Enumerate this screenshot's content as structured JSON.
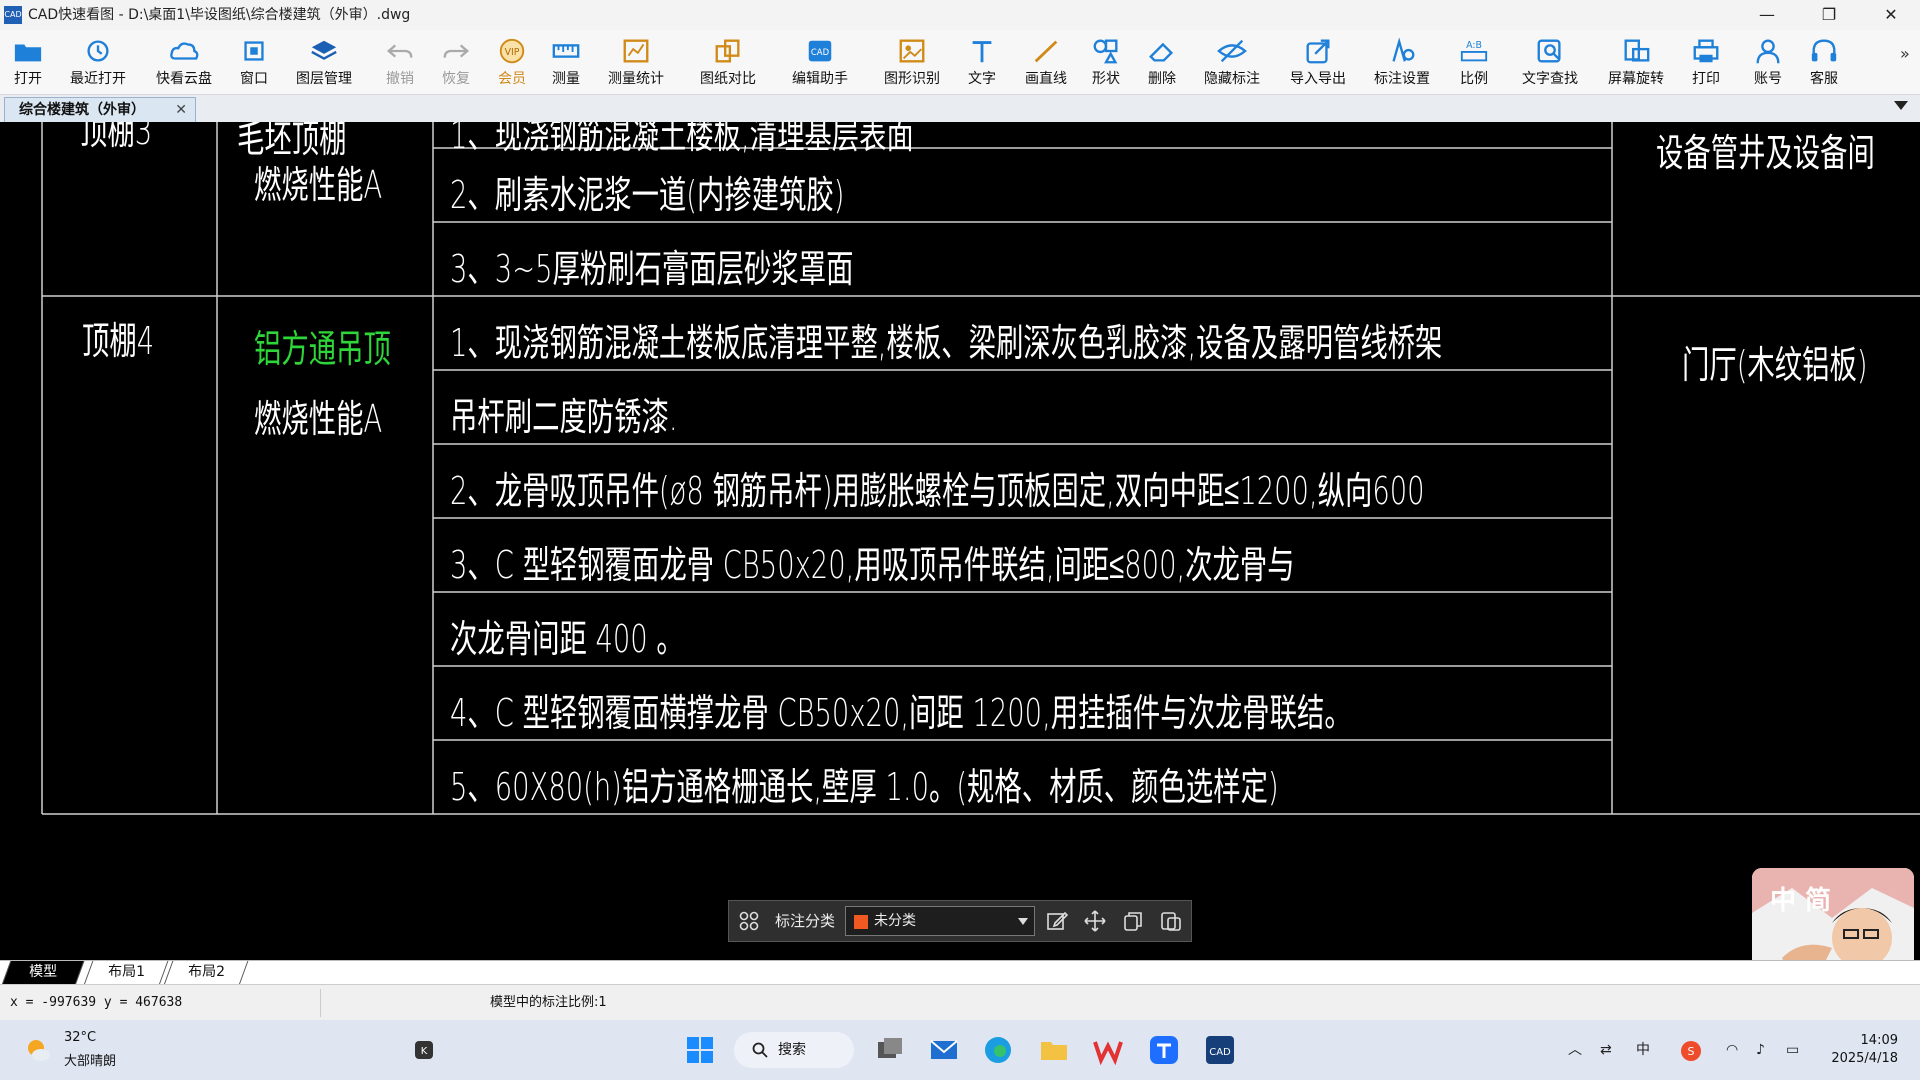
{
  "window": {
    "title": "CAD快速看图 - D:\\桌面1\\毕设图纸\\综合楼建筑（外审）.dwg",
    "controls": [
      "—",
      "❐",
      "✕"
    ]
  },
  "toolbar": [
    {
      "label": "打开",
      "icon": "folder-open-icon"
    },
    {
      "label": "最近打开",
      "icon": "history-icon"
    },
    {
      "label": "快看云盘",
      "icon": "cloud-icon"
    },
    {
      "label": "窗口",
      "icon": "window-icon"
    },
    {
      "label": "图层管理",
      "icon": "layers-icon"
    },
    {
      "label": "撤销",
      "icon": "undo-icon"
    },
    {
      "label": "恢复",
      "icon": "redo-icon"
    },
    {
      "label": "会员",
      "icon": "vip-icon"
    },
    {
      "label": "测量",
      "icon": "ruler-icon"
    },
    {
      "label": "测量统计",
      "icon": "measure-stats-icon"
    },
    {
      "label": "图纸对比",
      "icon": "compare-icon"
    },
    {
      "label": "编辑助手",
      "icon": "edit-assistant-icon"
    },
    {
      "label": "图形识别",
      "icon": "shape-recognition-icon"
    },
    {
      "label": "文字",
      "icon": "text-icon"
    },
    {
      "label": "画直线",
      "icon": "line-icon"
    },
    {
      "label": "形状",
      "icon": "shape-icon"
    },
    {
      "label": "删除",
      "icon": "eraser-icon"
    },
    {
      "label": "隐藏标注",
      "icon": "hide-annotation-icon"
    },
    {
      "label": "导入导出",
      "icon": "import-export-icon"
    },
    {
      "label": "标注设置",
      "icon": "annotation-settings-icon"
    },
    {
      "label": "比例",
      "icon": "scale-icon"
    },
    {
      "label": "文字查找",
      "icon": "text-search-icon"
    },
    {
      "label": "屏幕旋转",
      "icon": "rotate-screen-icon"
    },
    {
      "label": "打印",
      "icon": "printer-icon"
    },
    {
      "label": "账号",
      "icon": "account-icon"
    },
    {
      "label": "客服",
      "icon": "headset-icon"
    }
  ],
  "toolbar_more": "»",
  "document_tab": {
    "label": "综合楼建筑（外审）",
    "close": "✕"
  },
  "drawing": {
    "row1": {
      "col2_top": "毛坯顶棚",
      "col2_fire": "燃烧性能A",
      "items": [
        "1、现浇钢筋混凝土楼板,清理基层表面",
        "2、刷素水泥浆一道(内掺建筑胶)",
        "3、3~5厚粉刷石膏面层砂浆罩面"
      ],
      "location": "设备管井及设备间"
    },
    "row2": {
      "name": "顶棚4",
      "material": "铝方通吊顶",
      "fire": "燃烧性能A",
      "items": [
        "1、现浇钢筋混凝土楼板底清理平整,楼板、梁刷深灰色乳胶漆,设备及露明管线桥架",
        "吊杆刷二度防锈漆.",
        "2、龙骨吸顶吊件(ø8  钢筋吊杆)用膨胀螺栓与顶板固定,双向中距≤1200,纵向600",
        "3、C 型轻钢覆面龙骨 CB50x20,用吸顶吊件联结,间距≤800,次龙骨与",
        "次龙骨间距 400  。",
        "4、C 型轻钢覆面横撑龙骨 CB50x20,间距 1200,用挂插件与次龙骨联结。",
        "5、60X80(h)铝方通格栅通长,壁厚 1.0。(规格、材质、颜色选样定)"
      ],
      "location": "门厅(木纹铝板)"
    }
  },
  "annotation_bar": {
    "label": "标注分类",
    "selected": "未分类",
    "swatch": "#f05a22"
  },
  "layout_tabs": [
    "模型",
    "布局1",
    "布局2"
  ],
  "status": {
    "coords": "x = -997639  y = 467638",
    "scale_text": "模型中的标注比例:1"
  },
  "taskbar": {
    "temp": "32°C",
    "weather": "大部晴朗",
    "search": "搜索",
    "ime": "中",
    "time": "14:09",
    "date": "2025/4/18"
  },
  "avatar_widget": {
    "ime_text": "中 简"
  }
}
